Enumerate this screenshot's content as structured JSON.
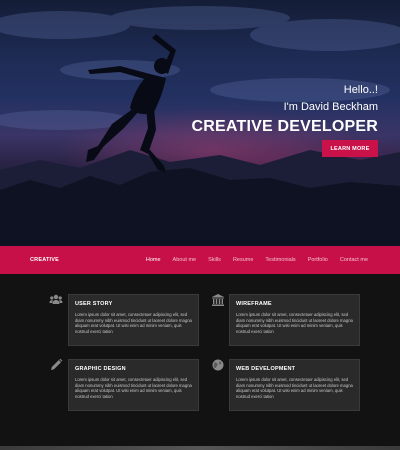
{
  "hero": {
    "greeting": "Hello..!",
    "intro": "I'm David Beckham",
    "headline": "CREATIVE DEVELOPER",
    "cta_label": "LEARN MORE"
  },
  "nav": {
    "brand": "CREATIVE",
    "items": [
      {
        "label": "Home",
        "active": true
      },
      {
        "label": "About me",
        "active": false
      },
      {
        "label": "Skills",
        "active": false
      },
      {
        "label": "Resume",
        "active": false
      },
      {
        "label": "Testimonials",
        "active": false
      },
      {
        "label": "Portfolio",
        "active": false
      },
      {
        "label": "Contact me",
        "active": false
      }
    ]
  },
  "services": [
    {
      "icon": "users-icon",
      "title": "USER STORY",
      "text": "Lorem ipsum dolor sit amet, consectetuer adipiscing elit, sed diam nonummy nibh euismod tincidunt ut laoreet dolore magna aliquam erat volutpat. Ut wisi enim ad minim veniam, quis nostrud exerci tation"
    },
    {
      "icon": "bank-icon",
      "title": "WIREFRAME",
      "text": "Lorem ipsum dolor sit amet, consectetuer adipiscing elit, sed diam nonummy nibh euismod tincidunt ut laoreet dolore magna aliquam erat volutpat. Ut wisi enim ad minim veniam, quis nostrud exerci tation"
    },
    {
      "icon": "pencil-icon",
      "title": "GRAPHIC DESIGN",
      "text": "Lorem ipsum dolor sit amet, consectetuer adipiscing elit, sed diam nonummy nibh euismod tincidunt ut laoreet dolore magna aliquam erat volutpat. Ut wisi enim ad minim veniam, quis nostrud exerci tation"
    },
    {
      "icon": "globe-icon",
      "title": "WEB DEVELOPMENT",
      "text": "Lorem ipsum dolor sit amet, consectetuer adipiscing elit, sed diam nonummy nibh euismod tincidunt ut laoreet dolore magna aliquam erat volutpat. Ut wisi enim ad minim veniam, quis nostrud exerci tation"
    }
  ],
  "colors": {
    "accent": "#c70f48",
    "background": "#121212",
    "card": "#2a2a2a"
  }
}
